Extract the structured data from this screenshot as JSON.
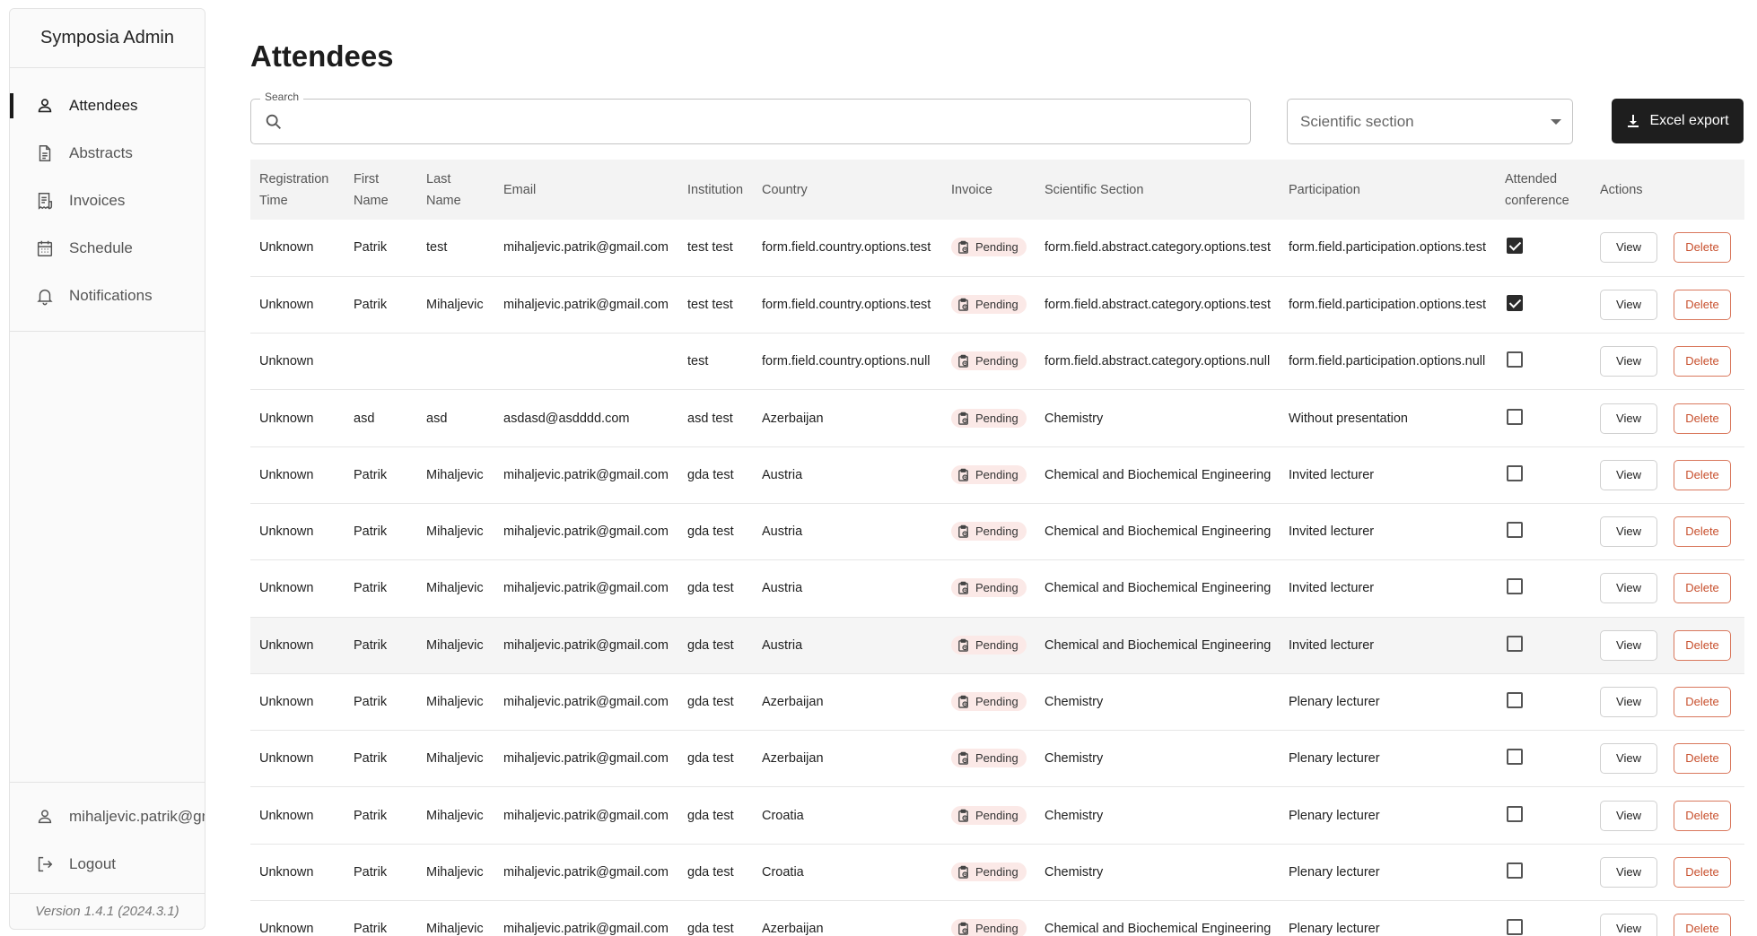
{
  "app": {
    "title": "Symposia Admin",
    "version": "Version 1.4.1 (2024.3.1)"
  },
  "sidebar": {
    "items": [
      {
        "label": "Attendees",
        "icon": "person-icon",
        "active": true
      },
      {
        "label": "Abstracts",
        "icon": "document-icon",
        "active": false
      },
      {
        "label": "Invoices",
        "icon": "receipt-icon",
        "active": false
      },
      {
        "label": "Schedule",
        "icon": "calendar-icon",
        "active": false
      },
      {
        "label": "Notifications",
        "icon": "bell-icon",
        "active": false
      }
    ],
    "user": "mihaljevic.patrik@gmail.com",
    "logout_label": "Logout"
  },
  "page": {
    "title": "Attendees",
    "search_label": "Search",
    "search_value": "",
    "section_placeholder": "Scientific section",
    "export_label": "Excel export"
  },
  "table": {
    "headers": [
      "Registration Time",
      "First Name",
      "Last Name",
      "Email",
      "Institution",
      "Country",
      "Invoice",
      "Scientific Section",
      "Participation",
      "Attended conference",
      "Actions"
    ],
    "view_label": "View",
    "delete_label": "Delete",
    "rows": [
      {
        "time": "Unknown",
        "first": "Patrik",
        "last": "test",
        "email": "mihaljevic.patrik@gmail.com",
        "inst": "test test",
        "country": "form.field.country.options.test",
        "invoice": "Pending",
        "section": "form.field.abstract.category.options.test",
        "participation": "form.field.participation.options.test",
        "attended": true
      },
      {
        "time": "Unknown",
        "first": "Patrik",
        "last": "Mihaljevic",
        "email": "mihaljevic.patrik@gmail.com",
        "inst": "test test",
        "country": "form.field.country.options.test",
        "invoice": "Pending",
        "section": "form.field.abstract.category.options.test",
        "participation": "form.field.participation.options.test",
        "attended": true
      },
      {
        "time": "Unknown",
        "first": "",
        "last": "",
        "email": "",
        "inst": "test",
        "country": "form.field.country.options.null",
        "invoice": "Pending",
        "section": "form.field.abstract.category.options.null",
        "participation": "form.field.participation.options.null",
        "attended": false
      },
      {
        "time": "Unknown",
        "first": "asd",
        "last": "asd",
        "email": "asdasd@asdddd.com",
        "inst": "asd test",
        "country": "Azerbaijan",
        "invoice": "Pending",
        "section": "Chemistry",
        "participation": "Without presentation",
        "attended": false
      },
      {
        "time": "Unknown",
        "first": "Patrik",
        "last": "Mihaljevic",
        "email": "mihaljevic.patrik@gmail.com",
        "inst": "gda test",
        "country": "Austria",
        "invoice": "Pending",
        "section": "Chemical and Biochemical Engineering",
        "participation": "Invited lecturer",
        "attended": false
      },
      {
        "time": "Unknown",
        "first": "Patrik",
        "last": "Mihaljevic",
        "email": "mihaljevic.patrik@gmail.com",
        "inst": "gda test",
        "country": "Austria",
        "invoice": "Pending",
        "section": "Chemical and Biochemical Engineering",
        "participation": "Invited lecturer",
        "attended": false
      },
      {
        "time": "Unknown",
        "first": "Patrik",
        "last": "Mihaljevic",
        "email": "mihaljevic.patrik@gmail.com",
        "inst": "gda test",
        "country": "Austria",
        "invoice": "Pending",
        "section": "Chemical and Biochemical Engineering",
        "participation": "Invited lecturer",
        "attended": false
      },
      {
        "time": "Unknown",
        "first": "Patrik",
        "last": "Mihaljevic",
        "email": "mihaljevic.patrik@gmail.com",
        "inst": "gda test",
        "country": "Austria",
        "invoice": "Pending",
        "section": "Chemical and Biochemical Engineering",
        "participation": "Invited lecturer",
        "attended": false,
        "highlight": true
      },
      {
        "time": "Unknown",
        "first": "Patrik",
        "last": "Mihaljevic",
        "email": "mihaljevic.patrik@gmail.com",
        "inst": "gda test",
        "country": "Azerbaijan",
        "invoice": "Pending",
        "section": "Chemistry",
        "participation": "Plenary lecturer",
        "attended": false
      },
      {
        "time": "Unknown",
        "first": "Patrik",
        "last": "Mihaljevic",
        "email": "mihaljevic.patrik@gmail.com",
        "inst": "gda test",
        "country": "Azerbaijan",
        "invoice": "Pending",
        "section": "Chemistry",
        "participation": "Plenary lecturer",
        "attended": false
      },
      {
        "time": "Unknown",
        "first": "Patrik",
        "last": "Mihaljevic",
        "email": "mihaljevic.patrik@gmail.com",
        "inst": "gda test",
        "country": "Croatia",
        "invoice": "Pending",
        "section": "Chemistry",
        "participation": "Plenary lecturer",
        "attended": false
      },
      {
        "time": "Unknown",
        "first": "Patrik",
        "last": "Mihaljevic",
        "email": "mihaljevic.patrik@gmail.com",
        "inst": "gda test",
        "country": "Croatia",
        "invoice": "Pending",
        "section": "Chemistry",
        "participation": "Plenary lecturer",
        "attended": false
      },
      {
        "time": "Unknown",
        "first": "Patrik",
        "last": "Mihaljevic",
        "email": "mihaljevic.patrik@gmail.com",
        "inst": "gda test",
        "country": "Azerbaijan",
        "invoice": "Pending",
        "section": "Chemical and Biochemical Engineering",
        "participation": "Plenary lecturer",
        "attended": false
      }
    ]
  }
}
